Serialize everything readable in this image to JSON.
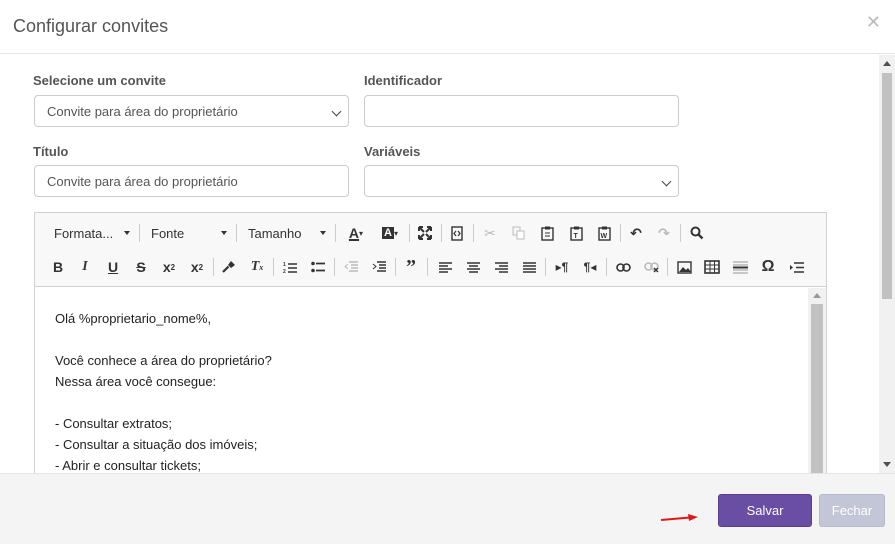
{
  "modal": {
    "title": "Configurar convites",
    "close_icon": "close-icon"
  },
  "form": {
    "invite_label": "Selecione um convite",
    "invite_value": "Convite para área do proprietário",
    "identifier_label": "Identificador",
    "identifier_value": "",
    "title_label": "Título",
    "title_value": "Convite para área do proprietário",
    "variables_label": "Variáveis",
    "variables_value": ""
  },
  "toolbar": {
    "format_label": "Formata...",
    "font_label": "Fonte",
    "size_label": "Tamanho",
    "icons_row1": [
      "text-color-icon",
      "background-color-icon",
      "maximize-icon",
      "source-icon",
      "cut-icon",
      "copy-icon",
      "paste-icon",
      "paste-text-icon",
      "paste-word-icon",
      "undo-icon",
      "redo-icon",
      "find-icon"
    ],
    "icons_row2": [
      "bold-icon",
      "italic-icon",
      "underline-icon",
      "strikethrough-icon",
      "subscript-icon",
      "superscript-icon",
      "copy-format-icon",
      "remove-format-icon",
      "numbered-list-icon",
      "bulleted-list-icon",
      "outdent-icon",
      "indent-icon",
      "blockquote-icon",
      "align-left-icon",
      "align-center-icon",
      "align-right-icon",
      "justify-icon",
      "ltr-icon",
      "rtl-icon",
      "link-icon",
      "unlink-icon",
      "image-icon",
      "table-icon",
      "horizontal-line-icon",
      "special-char-icon",
      "page-break-icon"
    ]
  },
  "editor": {
    "lines": [
      "Olá %proprietario_nome%,",
      "",
      "Você conhece a área do proprietário?",
      "Nessa área você consegue:",
      "",
      "- Consultar extratos;",
      "- Consultar a situação dos imóveis;",
      "- Abrir e consultar tickets;"
    ]
  },
  "footer": {
    "save_label": "Salvar",
    "close_label": "Fechar"
  },
  "colors": {
    "primary": "#6a4ea4",
    "disabled_button": "#c2c6d6",
    "annotation_arrow": "#e0161b"
  }
}
